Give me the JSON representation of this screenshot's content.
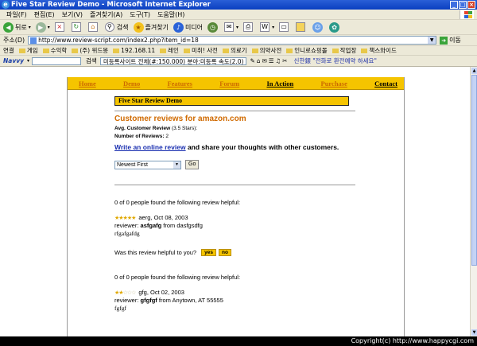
{
  "window": {
    "title": "Five Star Review Demo - Microsoft Internet Explorer"
  },
  "menu": [
    "파일(F)",
    "편집(E)",
    "보기(V)",
    "즐겨찾기(A)",
    "도구(T)",
    "도움말(H)"
  ],
  "toolbar": {
    "back": "뒤로",
    "search": "검색",
    "favorites": "즐겨찾기",
    "media": "미디어"
  },
  "address": {
    "label": "주소(D)",
    "url": "http://www.review-script.com/index2.php?item_id=18",
    "go": "이동"
  },
  "links": [
    "연결",
    "게임",
    "수익학",
    "(주) 위드몽",
    "192.168.11",
    "레인",
    "미취! 사전",
    "의료기",
    "의약사전",
    "인니로쇼핑몰",
    "작업장",
    "책스와이드"
  ],
  "navy": {
    "logo": "Navvy",
    "search": "검색",
    "ticker": "미등록사이트 전체(#:150.000) 분야:미등록 속도(2.0)",
    "msg": "신한銀 \"전화로 환전예약 하세요\""
  },
  "site_nav": [
    "Home",
    "Demo",
    "Features",
    "Forum",
    "In Action",
    "Purchase",
    "Contact"
  ],
  "page": {
    "title": "Five Star Review Demo",
    "heading": "Customer reviews for amazon.com",
    "avg_label": "Avg. Customer Review",
    "avg_value": "(3.5 Stars):",
    "num_label": "Number of Reviews:",
    "num_value": "2",
    "write_link": "Write an online review",
    "write_rest": " and share your thoughts with other customers.",
    "sort_selected": "Newest First",
    "go": "Go"
  },
  "reviews": [
    {
      "helpful": "0 of 0 people found the following review helpful:",
      "rating": 5,
      "title_date": "aerg, Oct 08, 2003",
      "reviewer_label": "reviewer:",
      "reviewer": "asfgafg",
      "from": "from dasfgsdfg",
      "body": "rfgafgafdg",
      "vote_q": "Was this review helpful to you?",
      "yes": "yes",
      "no": "no"
    },
    {
      "helpful": "0 of 0 people found the following review helpful:",
      "rating": 2,
      "title_date": "gfg, Oct 02, 2003",
      "reviewer_label": "reviewer:",
      "reviewer": "gfgfgf",
      "from": "from Anytown, AT 55555",
      "body": "fgfgf"
    }
  ],
  "status": {
    "text": "Copyright(c) http://www.happycgi.com"
  }
}
